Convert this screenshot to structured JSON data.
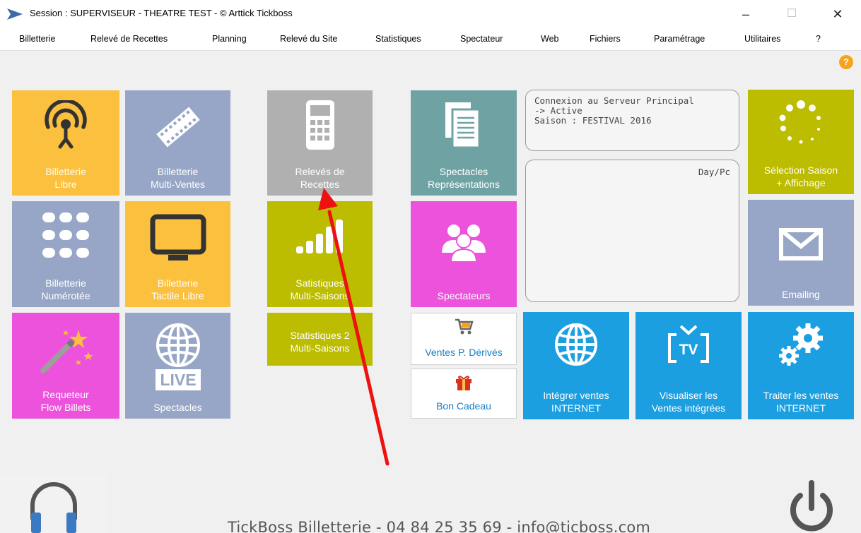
{
  "window": {
    "title": "Session : SUPERVISEUR - THEATRE TEST -  © Arttick Tickboss",
    "minimize": "–",
    "maximize": "☐",
    "close": "✕"
  },
  "menu": [
    "Billetterie",
    "Relevé de Recettes",
    "Planning",
    "Relevé du Site",
    "Statistiques",
    "Spectateur",
    "Web",
    "Fichiers",
    "Paramétrage",
    "Utilitaires",
    "?"
  ],
  "help_badge": "?",
  "tiles": {
    "billetterie_libre": "Billetterie\nLibre",
    "billetterie_multi_ventes": "Billetterie\nMulti-Ventes",
    "releves_recettes": "Relevés de\nRecettes",
    "spectacles_representations": "Spectacles\nReprésentations",
    "selection_saison": "Sélection Saison\n+ Affichage",
    "billetterie_numerotee": "Billetterie\nNumérotée",
    "billetterie_tactile": "Billetterie\nTactile Libre",
    "statistique_multi_saisons": "Satistiques\nMulti-Saisons",
    "spectateurs": "Spectateurs",
    "emailing": "Emailing",
    "requeteur": "Requeteur\nFlow Billets",
    "spectacles_live": "Spectacles",
    "statistiques_2": "Statistiques 2\nMulti-Saisons",
    "ventes_derives": "Ventes P. Dérivés",
    "bon_cadeau": "Bon Cadeau",
    "integrer_ventes": "Intégrer ventes\nINTERNET",
    "visualiser_ventes": "Visualiser les\nVentes intégrées",
    "traiter_ventes": "Traiter les ventes\nINTERNET"
  },
  "live_badge": "LIVE",
  "tv_badge": "TV",
  "server_status": "Connexion au Serveur Principal\n-> Active\nSaison : FESTIVAL 2016",
  "day_pc_label": "Day/Pc",
  "footer": "TickBoss Billetterie - 04 84 25 35 69 - info@ticboss.com",
  "colors": {
    "yellow": "#fbc03d",
    "slate": "#97a6c6",
    "grey": "#b0b0b0",
    "olive": "#bcbc00",
    "teal": "#6fa3a3",
    "pink": "#ec52dc",
    "blue": "#1b9fe0",
    "annotation_arrow": "#ee1111"
  }
}
